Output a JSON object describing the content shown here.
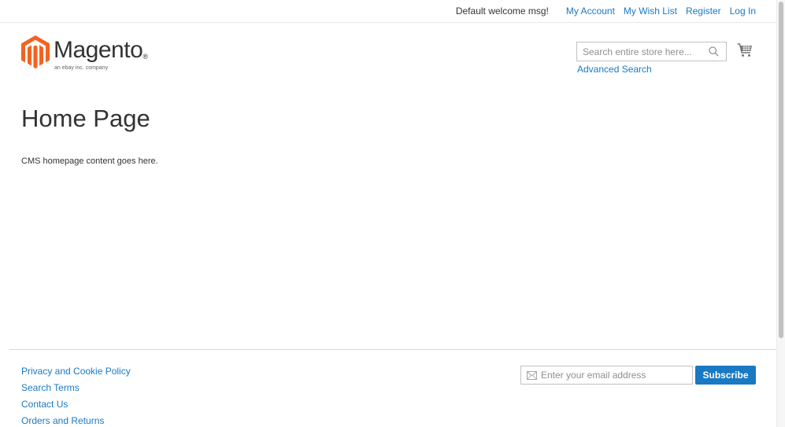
{
  "header": {
    "welcome": "Default welcome msg!",
    "links": [
      "My Account",
      "My Wish List",
      "Register",
      "Log In"
    ]
  },
  "logo": {
    "brand": "Magento",
    "reg": "®",
    "tagline": "an ebay inc. company",
    "color": "#f26322"
  },
  "search": {
    "placeholder": "Search entire store here...",
    "advanced_label": "Advanced Search",
    "icon": "search-icon"
  },
  "cart": {
    "icon": "cart-icon"
  },
  "main": {
    "title": "Home Page",
    "content": "CMS homepage content goes here."
  },
  "footer": {
    "links": [
      "Privacy and Cookie Policy",
      "Search Terms",
      "Contact Us",
      "Orders and Returns"
    ],
    "newsletter": {
      "placeholder": "Enter your email address",
      "button_label": "Subscribe",
      "icon": "mail-icon"
    }
  },
  "colors": {
    "link": "#1979c3",
    "button": "#1979c3",
    "text": "#333333"
  }
}
